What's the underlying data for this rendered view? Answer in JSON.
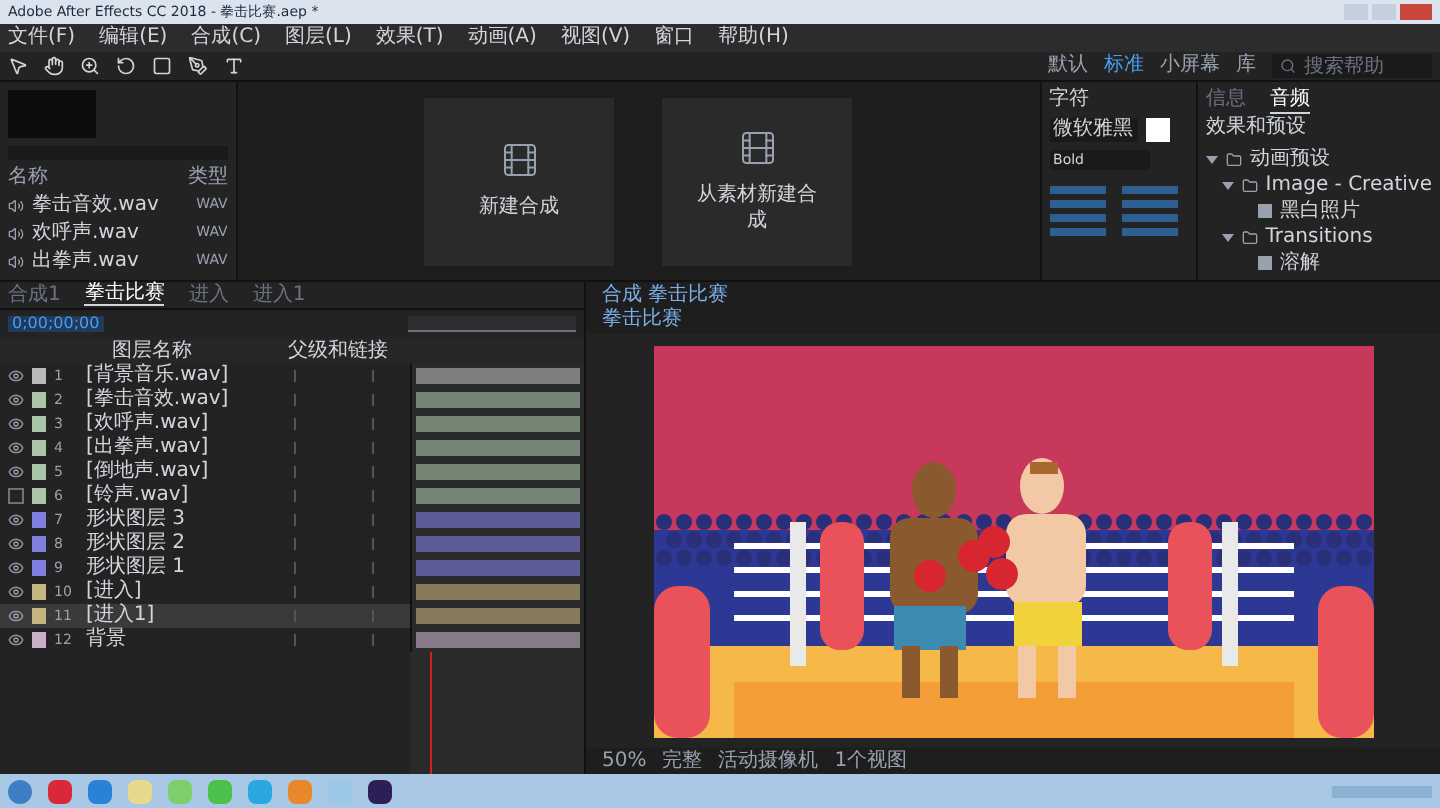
{
  "window": {
    "title": "Adobe After Effects CC 2018 - 拳击比赛.aep *"
  },
  "menu": [
    {
      "label": "文件(F)"
    },
    {
      "label": "编辑(E)"
    },
    {
      "label": "合成(C)"
    },
    {
      "label": "图层(L)"
    },
    {
      "label": "效果(T)"
    },
    {
      "label": "动画(A)"
    },
    {
      "label": "视图(V)"
    },
    {
      "label": "窗口"
    },
    {
      "label": "帮助(H)"
    }
  ],
  "workspaces": [
    {
      "label": "默认",
      "selected": false
    },
    {
      "label": "标准",
      "selected": true
    },
    {
      "label": "小屏幕",
      "selected": false
    },
    {
      "label": "库",
      "selected": false
    }
  ],
  "search_help": {
    "placeholder": "搜索帮助"
  },
  "project": {
    "columns": [
      "名称",
      "类型"
    ],
    "items": [
      {
        "name": "拳击音效.wav",
        "type": "WAV"
      },
      {
        "name": "欢呼声.wav",
        "type": "WAV"
      },
      {
        "name": "出拳声.wav",
        "type": "WAV"
      }
    ]
  },
  "home_cards": [
    {
      "label": "新建合成"
    },
    {
      "label": "从素材新建合成"
    }
  ],
  "character": {
    "title": "字符",
    "font": "微软雅黑",
    "style": "Bold"
  },
  "effects": {
    "tabs": [
      {
        "label": "信息",
        "selected": false
      },
      {
        "label": "音频",
        "selected": true
      }
    ],
    "title": "效果和预设",
    "tree": [
      {
        "label": "动画预设",
        "children": [
          {
            "label": "Image - Creative",
            "children": [
              {
                "label": "黑白照片"
              }
            ]
          },
          {
            "label": "Transitions",
            "children": [
              {
                "label": "溶解"
              }
            ]
          }
        ]
      }
    ]
  },
  "timeline": {
    "tabs": [
      {
        "label": "合成1",
        "selected": false
      },
      {
        "label": "拳击比赛",
        "selected": true
      },
      {
        "label": "进入",
        "selected": false
      },
      {
        "label": "进入1",
        "selected": false
      }
    ],
    "timecode": "0;00;00;00",
    "columns": [
      "图层名称",
      "父级和链接"
    ],
    "layers": [
      {
        "number": "1",
        "name": "[背景音乐.wav]",
        "color": "#b9b9b9",
        "visible": true,
        "selected": false
      },
      {
        "number": "2",
        "name": "[拳击音效.wav]",
        "color": "#a9c4a9",
        "visible": true,
        "selected": false
      },
      {
        "number": "3",
        "name": "[欢呼声.wav]",
        "color": "#a9c4a9",
        "visible": true,
        "selected": false
      },
      {
        "number": "4",
        "name": "[出拳声.wav]",
        "color": "#a9c4a9",
        "visible": true,
        "selected": false
      },
      {
        "number": "5",
        "name": "[倒地声.wav]",
        "color": "#a9c4a9",
        "visible": true,
        "selected": false
      },
      {
        "number": "6",
        "name": "[铃声.wav]",
        "color": "#a9c4a9",
        "visible": false,
        "selected": false
      },
      {
        "number": "7",
        "name": "形状图层 3",
        "color": "#7f7fe0",
        "visible": true,
        "selected": false
      },
      {
        "number": "8",
        "name": "形状图层 2",
        "color": "#7f7fe0",
        "visible": true,
        "selected": false
      },
      {
        "number": "9",
        "name": "形状图层 1",
        "color": "#7f7fe0",
        "visible": true,
        "selected": false
      },
      {
        "number": "10",
        "name": "[进入]",
        "color": "#c4b47f",
        "visible": true,
        "selected": false
      },
      {
        "number": "11",
        "name": "[进入1]",
        "color": "#c4b47f",
        "visible": true,
        "selected": true
      },
      {
        "number": "12",
        "name": "背景",
        "color": "#c9b0c9",
        "visible": true,
        "selected": false
      }
    ]
  },
  "viewer": {
    "tab": "合成 拳击比赛",
    "breadcrumb": "拳击比赛",
    "toolbar": [
      "50%",
      "完整",
      "活动摄像机",
      "1个视图"
    ]
  }
}
